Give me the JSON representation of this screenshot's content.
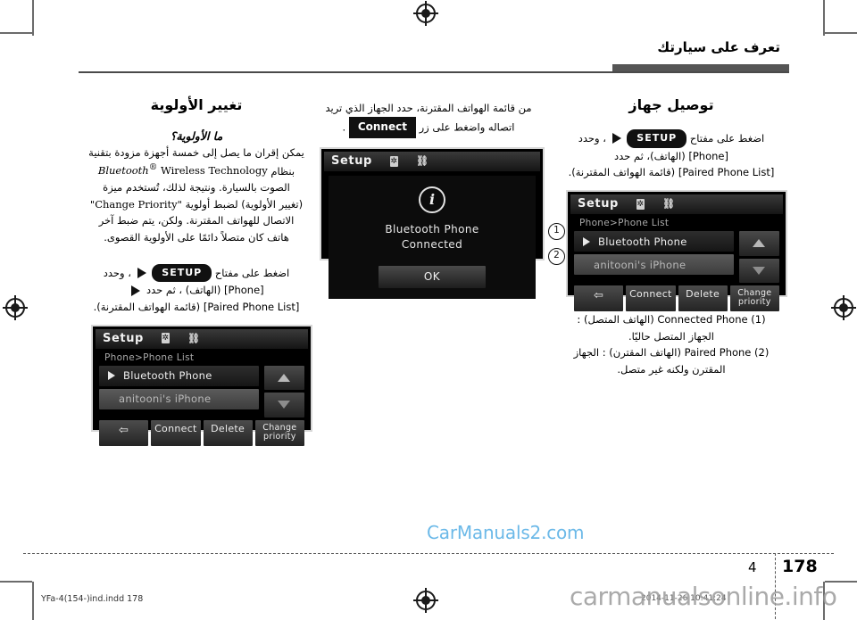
{
  "page": {
    "header_title": "تعرف على سيارتك",
    "section_number": "4",
    "page_number": "178",
    "indd_filename": "YFa-4(154-)ind.indd   178",
    "date_stamp": "2014-11-26   10:41:24",
    "watermark_blue": "CarManuals2.com",
    "watermark_grey": "carmanualsonline.info"
  },
  "columns": {
    "right": {
      "title": "توصيل جهاز",
      "step_line1_pre": "اضغط على مفتاح",
      "step_key": "SETUP",
      "step_line1_post": "، وحدد",
      "step_line2": "[Phone] (الهاتف)، ثم حدد",
      "step_line3": "[Paired Phone List] (قائمة الهواتف المقترنة).",
      "callouts": [
        "1",
        "2"
      ],
      "legend": [
        "(1) Connected Phone (الهاتف المتصل) :",
        "الجهاز المتصل حاليًا.",
        "(2) Paired Phone (الهاتف المقترن) : الجهاز",
        "المقترن ولكنه غير متصل."
      ]
    },
    "middle": {
      "intro_line1": "من قائمة الهواتف المقترنة، حدد الجهاز الذي تريد",
      "intro_line2_pre": "اتصاله واضغط على زر",
      "intro_key": "Connect",
      "intro_line2_post": "."
    },
    "left": {
      "title": "تغيير الأولوية",
      "subtitle": "ما الأولوية؟",
      "body_line1": "يمكن إقران ما يصل إلى خمسة أجهزة مزودة بتقنية",
      "body_bt": "Bluetooth",
      "body_bt_sup": "®",
      "body_bt_rest": " Wireless Technology",
      "body_line2_pre": "بنظام",
      "body_line3": "الصوت بالسيارة. ونتيجة لذلك، تُستخدم ميزة",
      "body_line4_key": "\"Change Priority\"",
      "body_line4": "(تغيير الأولوية) لضبط أولوية",
      "body_line5": "الاتصال للهواتف المقترنة. ولكن، يتم ضبط آخر",
      "body_line6": "هاتف كان متصلاً دائمًا على الأولوية القصوى.",
      "step_line1_pre": "اضغط على مفتاح",
      "step_key": "SETUP",
      "step_line1_post": "، وحدد",
      "step_line2": "[Phone] (الهاتف) ، ثم حدد",
      "step_line3": "[Paired Phone List] (قائمة الهواتف المقترنة)."
    }
  },
  "screens": {
    "phone_list": {
      "title": "Setup",
      "bluetooth_icon": "bluetooth-icon",
      "usb_icon": "usb-icon",
      "breadcrumb": "Phone>Phone List",
      "rows": [
        {
          "label": "Bluetooth Phone",
          "state": "connected"
        },
        {
          "label": "anitooni's iPhone",
          "state": "paired"
        }
      ],
      "scroll_up": "scroll-up-arrow",
      "scroll_down": "scroll-down-arrow",
      "softkeys": [
        {
          "label": "",
          "icon": "back-arrow-icon"
        },
        {
          "label": "Connect",
          "icon": ""
        },
        {
          "label": "Delete",
          "icon": ""
        },
        {
          "label": "Change\npriority",
          "icon": ""
        }
      ],
      "softkey_change_line1": "Change",
      "softkey_change_line2": "priority",
      "softkey_back_glyph": "⇦",
      "softkey_connect": "Connect",
      "softkey_delete": "Delete"
    },
    "popup": {
      "title": "Setup",
      "info_glyph": "i",
      "message_line1": "Bluetooth Phone",
      "message_line2": "Connected",
      "ok_label": "OK"
    }
  },
  "colors": {
    "watermark_blue": "#6cb9e8",
    "watermark_grey": "#9c9c9c",
    "rule": "#4a4a4a",
    "screen_bg": "#000000"
  }
}
